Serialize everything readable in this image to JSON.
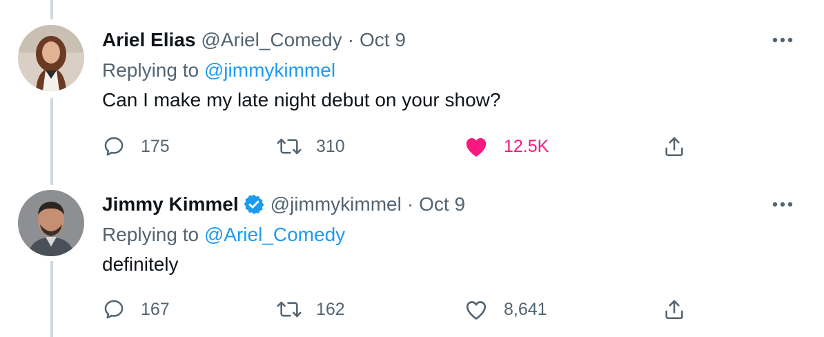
{
  "tweets": [
    {
      "author_name": "Ariel Elias",
      "author_handle": "@Ariel_Comedy",
      "separator": "·",
      "date": "Oct 9",
      "verified": false,
      "replying_prefix": "Replying to",
      "replying_to": "@jimmykimmel",
      "text": "Can I make my late night debut on your show?",
      "replies": "175",
      "retweets": "310",
      "likes": "12.5K",
      "liked": true
    },
    {
      "author_name": "Jimmy Kimmel",
      "author_handle": "@jimmykimmel",
      "separator": "·",
      "date": "Oct 9",
      "verified": true,
      "replying_prefix": "Replying to",
      "replying_to": "@Ariel_Comedy",
      "text": "definitely",
      "replies": "167",
      "retweets": "162",
      "likes": "8,641",
      "liked": false
    }
  ],
  "icons": {
    "reply": "reply-icon",
    "retweet": "retweet-icon",
    "like": "heart-icon",
    "share": "share-icon",
    "more": "more-options-icon",
    "verified": "verified-badge-icon"
  },
  "colors": {
    "link": "#1d9bf0",
    "like_active": "#f91880",
    "muted": "#536471",
    "text": "#0f1419",
    "thread_line": "#cfd9de"
  }
}
